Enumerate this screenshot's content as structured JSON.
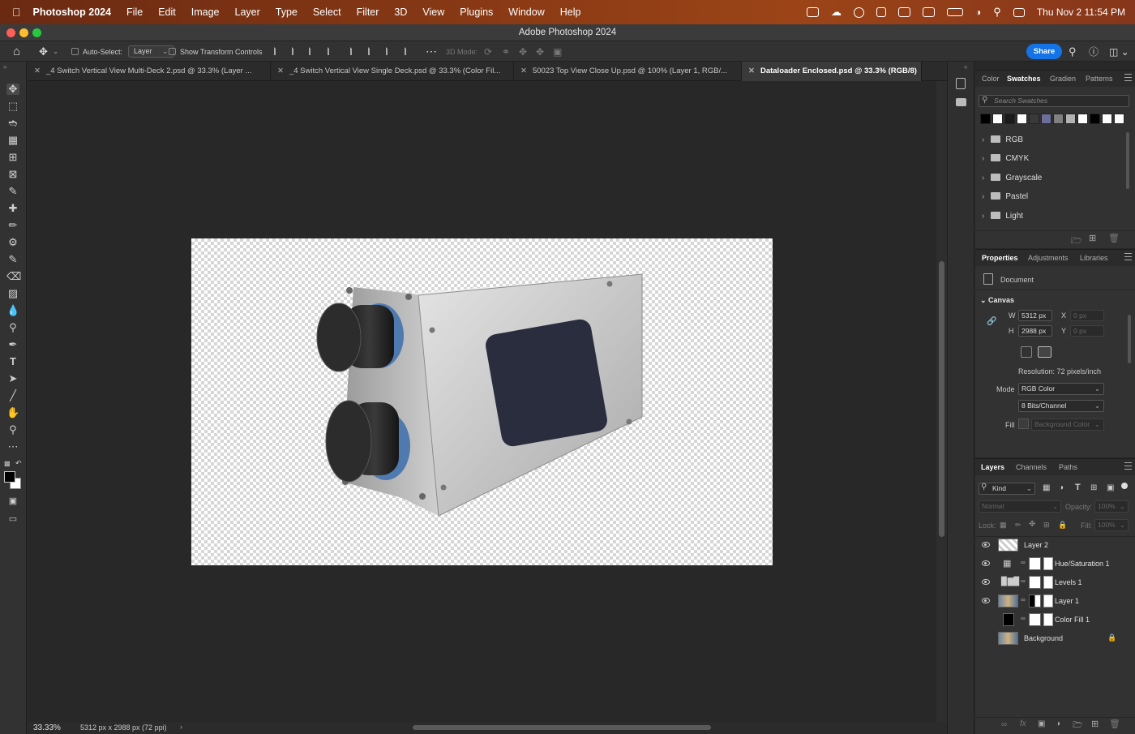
{
  "menubar": {
    "app_name": "Photoshop 2024",
    "items": [
      "File",
      "Edit",
      "Image",
      "Layer",
      "Type",
      "Select",
      "Filter",
      "3D",
      "View",
      "Plugins",
      "Window",
      "Help"
    ],
    "clock": "Thu Nov 2  11:54 PM"
  },
  "window": {
    "title": "Adobe Photoshop 2024"
  },
  "options": {
    "auto_select_label": "Auto-Select:",
    "auto_select_value": "Layer",
    "show_transform_label": "Show Transform Controls",
    "mode_3d_label": "3D Mode:",
    "share_label": "Share"
  },
  "tabs": [
    {
      "label": "_4 Switch Vertical View Multi-Deck 2.psd @ 33.3% (Layer ..."
    },
    {
      "label": "_4 Switch Vertical View Single Deck.psd @ 33.3% (Color Fil..."
    },
    {
      "label": "50023 Top View Close Up.psd @ 100% (Layer 1, RGB/..."
    },
    {
      "label": "Dataloader Enclosed.psd @ 33.3% (RGB/8)"
    }
  ],
  "status": {
    "zoom": "33.33%",
    "doc_info": "5312 px x 2988 px (72 ppi)"
  },
  "swatches_panel": {
    "tabs": [
      "Color",
      "Swatches",
      "Gradien",
      "Patterns"
    ],
    "search_placeholder": "Search Swatches",
    "colors": [
      "#000000",
      "#ffffff",
      "#1a1a1a",
      "#ffffff",
      "#3a3a3a",
      "#6b6f9a",
      "#808080",
      "#b3b3b3",
      "#ffffff",
      "#000000",
      "#ffffff",
      "#ffffff"
    ],
    "groups": [
      "RGB",
      "CMYK",
      "Grayscale",
      "Pastel",
      "Light"
    ]
  },
  "properties_panel": {
    "tabs": [
      "Properties",
      "Adjustments",
      "Libraries"
    ],
    "doc_label": "Document",
    "canvas_label": "Canvas",
    "w_label": "W",
    "w_value": "5312 px",
    "h_label": "H",
    "h_value": "2988 px",
    "x_label": "X",
    "x_value": "0 px",
    "y_label": "Y",
    "y_value": "0 px",
    "resolution": "Resolution: 72 pixels/inch",
    "mode_label": "Mode",
    "mode_value": "RGB Color",
    "bits_value": "8 Bits/Channel",
    "fill_label": "Fill",
    "fill_value": "Background Color"
  },
  "layers_panel": {
    "tabs": [
      "Layers",
      "Channels",
      "Paths"
    ],
    "filter_kind": "Kind",
    "blend_mode": "Normal",
    "opacity_label": "Opacity:",
    "opacity_value": "100%",
    "lock_label": "Lock:",
    "fill_label": "Fill:",
    "fill_value": "100%",
    "layers": [
      {
        "name": "Layer 2",
        "visible": true
      },
      {
        "name": "Hue/Saturation 1",
        "visible": true
      },
      {
        "name": "Levels 1",
        "visible": true
      },
      {
        "name": "Layer 1",
        "visible": true
      },
      {
        "name": "Color Fill 1",
        "visible": false
      },
      {
        "name": "Background",
        "visible": false
      }
    ]
  }
}
